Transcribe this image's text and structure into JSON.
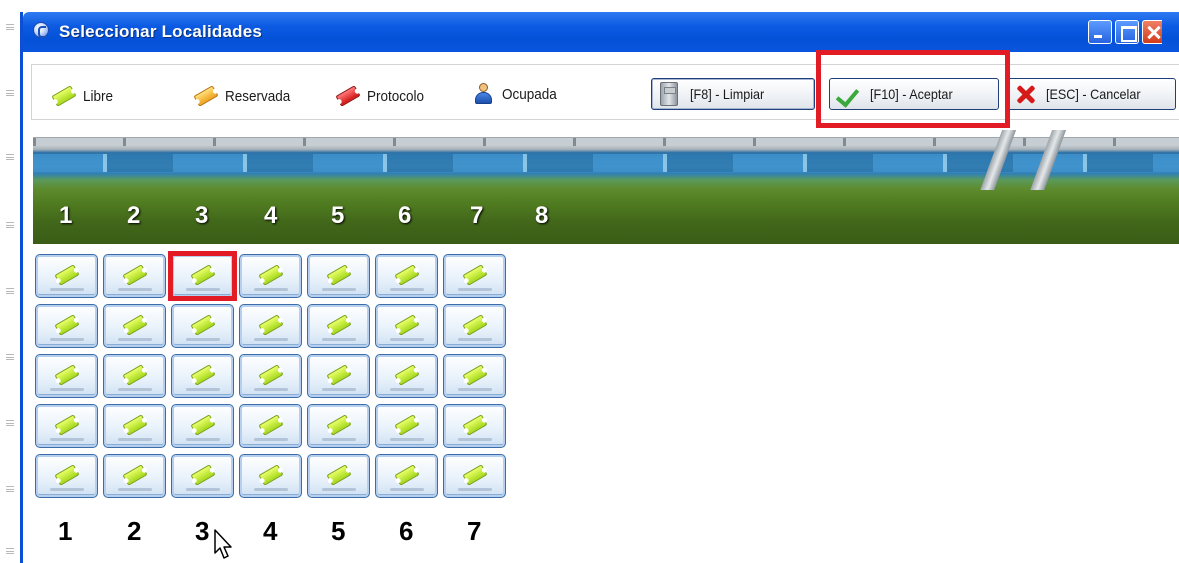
{
  "window": {
    "title": "Seleccionar Localidades",
    "controls": [
      "minimize",
      "maximize",
      "close"
    ]
  },
  "legend": [
    {
      "label": "Libre",
      "icon": "ticket-green-icon"
    },
    {
      "label": "Reservada",
      "icon": "ticket-orange-icon"
    },
    {
      "label": "Protocolo",
      "icon": "ticket-red-icon"
    },
    {
      "label": "Ocupada",
      "icon": "person-icon"
    }
  ],
  "toolbar": {
    "clear_label": "[F8] - Limpiar",
    "accept_label": "[F10] - Aceptar",
    "cancel_label": "[ESC] - Cancelar"
  },
  "banner": {
    "numbers": [
      "1",
      "2",
      "3",
      "4",
      "5",
      "6",
      "7",
      "8"
    ]
  },
  "seats": {
    "rows": 5,
    "columns": 7,
    "state": "Libre",
    "highlighted": {
      "row": 1,
      "column": 3
    },
    "column_numbers": [
      "1",
      "2",
      "3",
      "4",
      "5",
      "6",
      "7"
    ]
  },
  "colors": {
    "title_bar": "#0452d8",
    "highlight": "#e21b25",
    "libre": "#a6d91c"
  }
}
